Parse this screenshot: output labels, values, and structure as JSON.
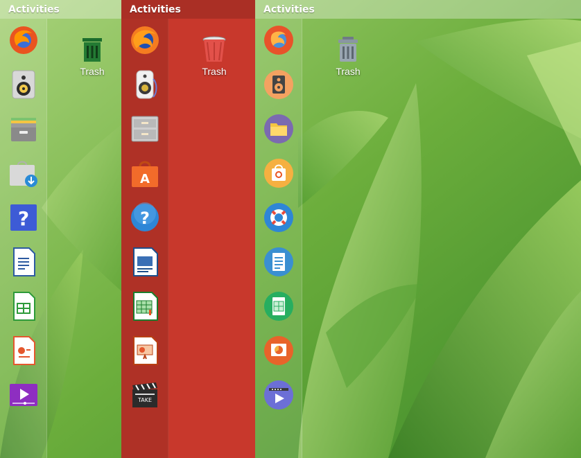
{
  "panels": [
    {
      "activities_label": "Activities",
      "trash_label": "Trash",
      "dock": [
        {
          "name": "firefox-icon"
        },
        {
          "name": "rhythmbox-icon"
        },
        {
          "name": "files-icon"
        },
        {
          "name": "software-icon"
        },
        {
          "name": "help-icon"
        },
        {
          "name": "writer-icon"
        },
        {
          "name": "calc-icon"
        },
        {
          "name": "impress-icon"
        },
        {
          "name": "videos-icon"
        }
      ]
    },
    {
      "activities_label": "Activities",
      "trash_label": "Trash",
      "dock": [
        {
          "name": "firefox-icon"
        },
        {
          "name": "rhythmbox-icon"
        },
        {
          "name": "files-icon"
        },
        {
          "name": "software-icon"
        },
        {
          "name": "help-icon"
        },
        {
          "name": "writer-icon"
        },
        {
          "name": "calc-icon"
        },
        {
          "name": "impress-icon"
        },
        {
          "name": "videos-icon"
        }
      ]
    },
    {
      "activities_label": "Activities",
      "trash_label": "Trash",
      "dock": [
        {
          "name": "firefox-icon"
        },
        {
          "name": "rhythmbox-icon"
        },
        {
          "name": "files-icon"
        },
        {
          "name": "software-icon"
        },
        {
          "name": "help-icon"
        },
        {
          "name": "writer-icon"
        },
        {
          "name": "calc-icon"
        },
        {
          "name": "impress-icon"
        },
        {
          "name": "videos-icon"
        }
      ]
    }
  ],
  "colors": {
    "panel2_background": "#c8382c",
    "wallpaper_green": "#7db84a"
  }
}
